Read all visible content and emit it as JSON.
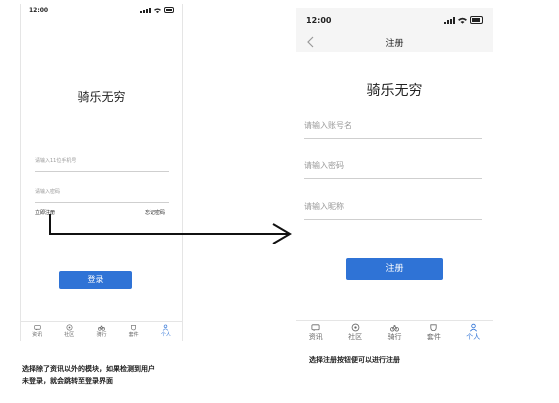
{
  "left_screen": {
    "status_time": "12:00",
    "app_title": "骑乐无穷",
    "phone_placeholder": "请输入11位手机号",
    "password_placeholder": "请输入密码",
    "register_link": "立即注册",
    "forgot_link": "忘记密码",
    "login_button": "登录"
  },
  "right_screen": {
    "status_time": "12:00",
    "nav_title": "注册",
    "app_title": "骑乐无穷",
    "account_placeholder": "请输入账号名",
    "password_placeholder": "请输入密码",
    "nickname_placeholder": "请输入昵称",
    "register_button": "注册"
  },
  "tabs": [
    {
      "label": "资讯",
      "icon": "message-icon"
    },
    {
      "label": "社区",
      "icon": "community-icon"
    },
    {
      "label": "骑行",
      "icon": "bike-icon"
    },
    {
      "label": "套件",
      "icon": "kit-icon"
    },
    {
      "label": "个人",
      "icon": "person-icon"
    }
  ],
  "active_tab": "个人",
  "captions": {
    "left_line1": "选择除了资讯以外的模块，如果检测到用户",
    "left_line2": "未登录，就会跳转至登录界面",
    "right": "选择注册按钮便可以进行注册"
  },
  "colors": {
    "accent": "#2f73d6"
  }
}
